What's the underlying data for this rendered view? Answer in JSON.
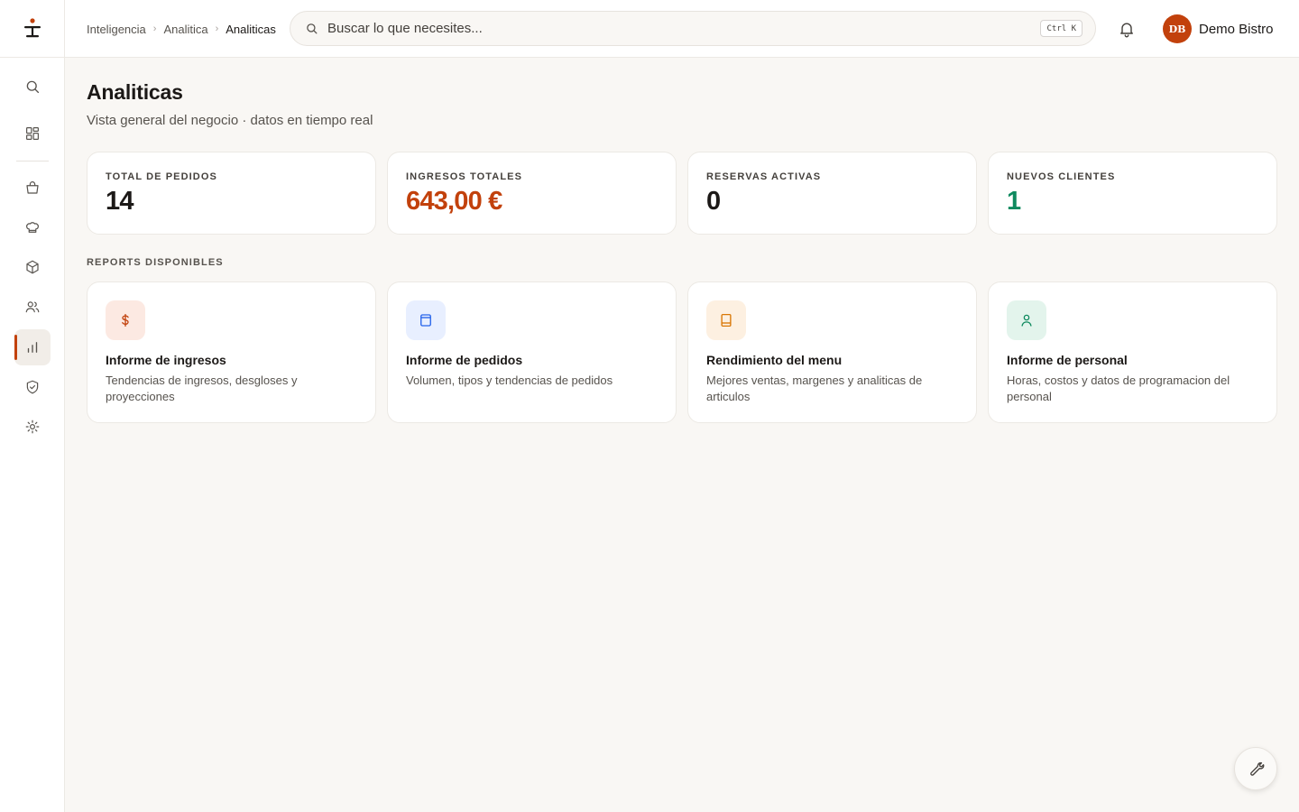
{
  "breadcrumb": {
    "items": [
      "Inteligencia",
      "Analitica"
    ],
    "current": "Analiticas"
  },
  "search": {
    "placeholder": "Buscar lo que necesites...",
    "shortcut": "Ctrl K"
  },
  "user": {
    "initials": "DB",
    "name": "Demo Bistro"
  },
  "page": {
    "title": "Analiticas",
    "subtitle": "Vista general del negocio · datos en tiempo real"
  },
  "stats": [
    {
      "label": "TOTAL DE PEDIDOS",
      "value": "14",
      "color": "#1c1917"
    },
    {
      "label": "INGRESOS TOTALES",
      "value": "643,00 €",
      "color": "#c2410c"
    },
    {
      "label": "RESERVAS ACTIVAS",
      "value": "0",
      "color": "#1c1917"
    },
    {
      "label": "NUEVOS CLIENTES",
      "value": "1",
      "color": "#0f8a5f"
    }
  ],
  "reports_section_label": "REPORTS DISPONIBLES",
  "reports": [
    {
      "icon": "dollar-icon",
      "title": "Informe de ingresos",
      "description": "Tendencias de ingresos, desgloses y proyecciones",
      "icon_color": "#c2410c",
      "icon_bg": "#fce9e2"
    },
    {
      "icon": "clipboard-icon",
      "title": "Informe de pedidos",
      "description": "Volumen, tipos y tendencias de pedidos",
      "icon_color": "#2563eb",
      "icon_bg": "#e8efff"
    },
    {
      "icon": "book-icon",
      "title": "Rendimiento del menu",
      "description": "Mejores ventas, margenes y analiticas de articulos",
      "icon_color": "#d97706",
      "icon_bg": "#fdf0e1"
    },
    {
      "icon": "user-icon",
      "title": "Informe de personal",
      "description": "Horas, costos y datos de programacion del personal",
      "icon_color": "#0f8a5f",
      "icon_bg": "#e3f4ec"
    }
  ],
  "sidebar_icons": [
    "search-icon",
    "dashboard-icon",
    "shopping-bag-icon",
    "chef-hat-icon",
    "package-icon",
    "users-icon",
    "bar-chart-icon",
    "shield-icon",
    "settings-icon"
  ],
  "accent_color": "#c2410c"
}
